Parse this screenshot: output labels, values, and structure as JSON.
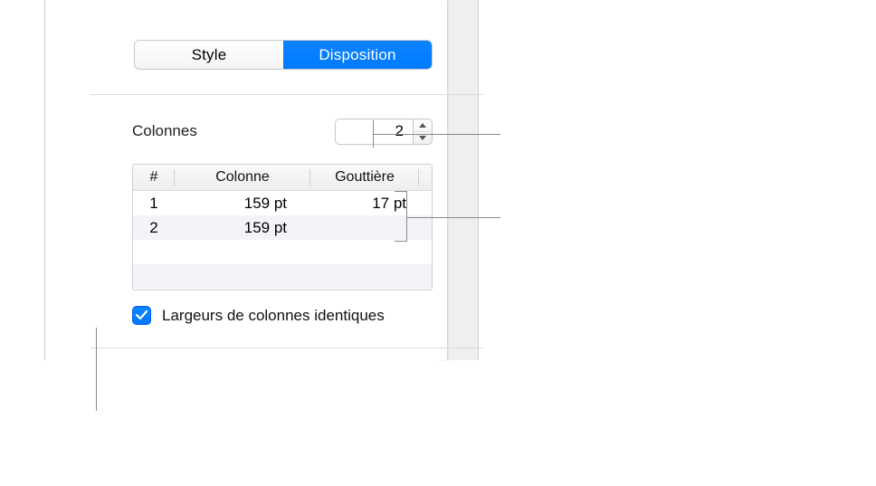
{
  "tabs": {
    "style": "Style",
    "disposition": "Disposition",
    "active": "disposition"
  },
  "columns_section": {
    "label": "Colonnes",
    "count_value": "2"
  },
  "table": {
    "headers": {
      "num": "#",
      "col": "Colonne",
      "gutter": "Gouttière"
    },
    "rows": [
      {
        "num": "1",
        "col": "159 pt",
        "gutter": "17 pt"
      },
      {
        "num": "2",
        "col": "159 pt",
        "gutter": ""
      }
    ]
  },
  "equal_width": {
    "label": "Largeurs de colonnes identiques",
    "checked": true
  }
}
